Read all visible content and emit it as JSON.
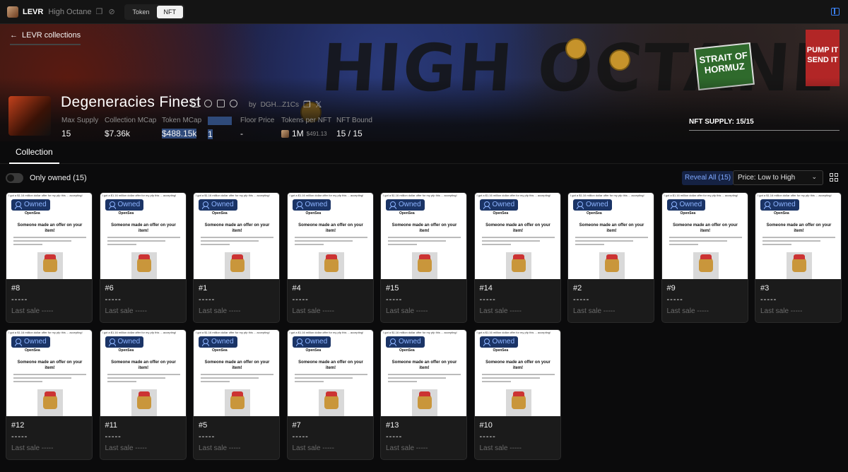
{
  "topbar": {
    "brand": "LEVR",
    "collection_name": "High Octane",
    "toggle": [
      "Token",
      "NFT"
    ],
    "active_toggle": "NFT"
  },
  "banner": {
    "back_label": "LEVR collections",
    "art_text": "HIGH OCTANE",
    "sign_text_1": "STRAIT OF HORMUZ",
    "sign_text_2": "PUMP IT SEND IT"
  },
  "collection": {
    "title": "Degeneracies Finest",
    "by_label": "by",
    "creator": "DGH...Z1Cs",
    "stats": [
      {
        "label": "Max Supply",
        "value": "15"
      },
      {
        "label": "Collection MCap",
        "value": "$7.36k"
      },
      {
        "label": "Token MCap",
        "value": "$488.15k"
      },
      {
        "label": "",
        "value": "1"
      },
      {
        "label": "Floor Price",
        "value": "-"
      },
      {
        "label": "Tokens per NFT",
        "value": "1M",
        "sub": "$491.13"
      },
      {
        "label": "NFT Bound",
        "value": "15 / 15"
      }
    ],
    "nft_supply": "NFT SUPPLY: 15/15"
  },
  "tabs": {
    "collection": "Collection"
  },
  "filters": {
    "only_owned": "Only owned (15)",
    "reveal_all": "Reveal All (15)",
    "sort": "Price: Low to High"
  },
  "card_image": {
    "topline": "I got a $1.16 million dollar offer for my pfp this ... accepting!",
    "marketplace": "OpenSea",
    "headline": "Someone made an offer on your item!",
    "badge": "Owned"
  },
  "cards": [
    {
      "id": "#8",
      "price": "-----",
      "last_sale": "Last sale -----"
    },
    {
      "id": "#6",
      "price": "-----",
      "last_sale": "Last sale -----"
    },
    {
      "id": "#1",
      "price": "-----",
      "last_sale": "Last sale -----"
    },
    {
      "id": "#4",
      "price": "-----",
      "last_sale": "Last sale -----"
    },
    {
      "id": "#15",
      "price": "-----",
      "last_sale": "Last sale -----"
    },
    {
      "id": "#14",
      "price": "-----",
      "last_sale": "Last sale -----"
    },
    {
      "id": "#2",
      "price": "-----",
      "last_sale": "Last sale -----"
    },
    {
      "id": "#9",
      "price": "-----",
      "last_sale": "Last sale -----"
    },
    {
      "id": "#3",
      "price": "-----",
      "last_sale": "Last sale -----"
    },
    {
      "id": "#12",
      "price": "-----",
      "last_sale": "Last sale -----"
    },
    {
      "id": "#11",
      "price": "-----",
      "last_sale": "Last sale -----"
    },
    {
      "id": "#5",
      "price": "-----",
      "last_sale": "Last sale -----"
    },
    {
      "id": "#7",
      "price": "-----",
      "last_sale": "Last sale -----"
    },
    {
      "id": "#13",
      "price": "-----",
      "last_sale": "Last sale -----"
    },
    {
      "id": "#10",
      "price": "-----",
      "last_sale": "Last sale -----"
    }
  ],
  "colors": {
    "accent": "#3b82f6",
    "badge_bg": "#1b3466",
    "badge_text": "#8db4ff",
    "background": "#0b0b0c"
  }
}
